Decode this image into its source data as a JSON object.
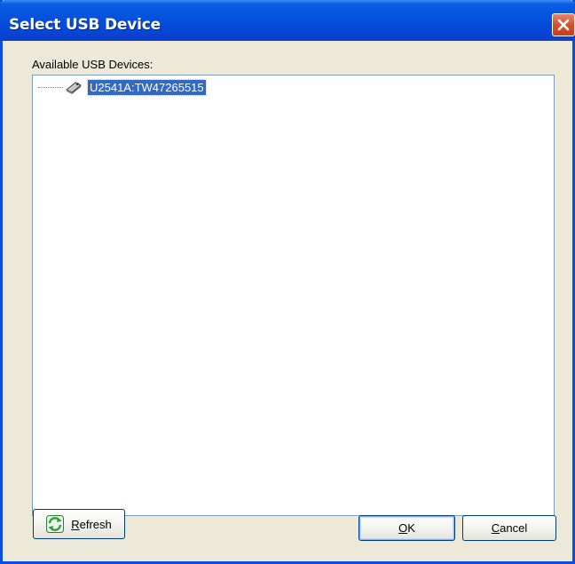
{
  "window": {
    "title": "Select USB Device"
  },
  "devices_label": "Available USB Devices:",
  "devices": [
    {
      "label": "U2541A:TW47265515",
      "selected": true
    }
  ],
  "buttons": {
    "refresh": {
      "mnemonic": "R",
      "rest": "efresh"
    },
    "ok": {
      "mnemonic": "O",
      "rest": "K"
    },
    "cancel": {
      "mnemonic": "C",
      "rest": "ancel"
    }
  },
  "colors": {
    "titlebar": "#0551dc",
    "window_bg": "#ece9d8",
    "selection": "#316ac5",
    "close_button": "#d5512b"
  },
  "icons": {
    "close": "close-icon",
    "usb_device": "usb-device-icon",
    "refresh": "refresh-icon"
  }
}
